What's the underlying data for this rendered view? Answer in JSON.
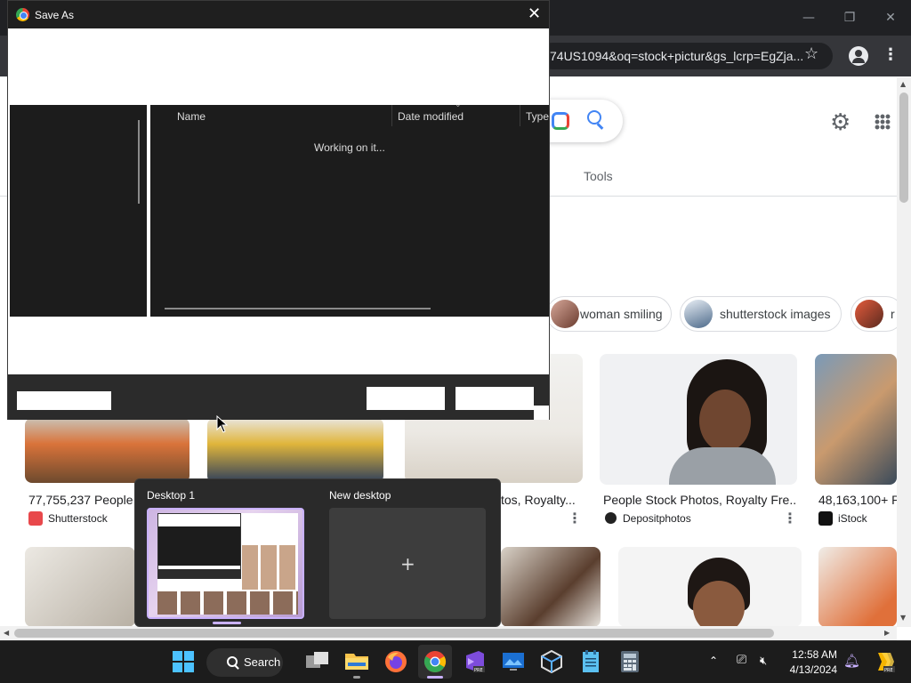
{
  "dialog": {
    "title": "Save As",
    "columns": {
      "name": "Name",
      "date_modified": "Date modified",
      "type": "Type"
    },
    "status": "Working on it..."
  },
  "browser": {
    "url": "74US1094&oq=stock+pictur&gs_lcrp=EgZja...",
    "tools_label": "Tools",
    "chips": [
      {
        "label": "woman smiling"
      },
      {
        "label": "shutterstock images"
      },
      {
        "label": "r"
      }
    ],
    "results_row1": [
      {
        "title": "77,755,237 People I",
        "source": "Shutterstock",
        "source_color": "#e8484b"
      },
      {
        "title": "tos, Royalty...",
        "source": ""
      },
      {
        "title": "People Stock Photos, Royalty Fre...",
        "source": "Depositphotos",
        "source_color": "#222222"
      },
      {
        "title": "48,163,100+ Pe",
        "source": "iStock",
        "source_color": "#111111"
      }
    ]
  },
  "task_view": {
    "desktops": [
      {
        "label": "Desktop 1"
      },
      {
        "label": "New desktop"
      }
    ]
  },
  "taskbar": {
    "search_label": "Search",
    "time": "12:58 AM",
    "date": "4/13/2024"
  },
  "colors": {
    "dialog_dark": "#1c1c1c",
    "taskbar": "#1c1c1c",
    "accent": "#c9b1ff",
    "chrome_dark": "#202124"
  }
}
